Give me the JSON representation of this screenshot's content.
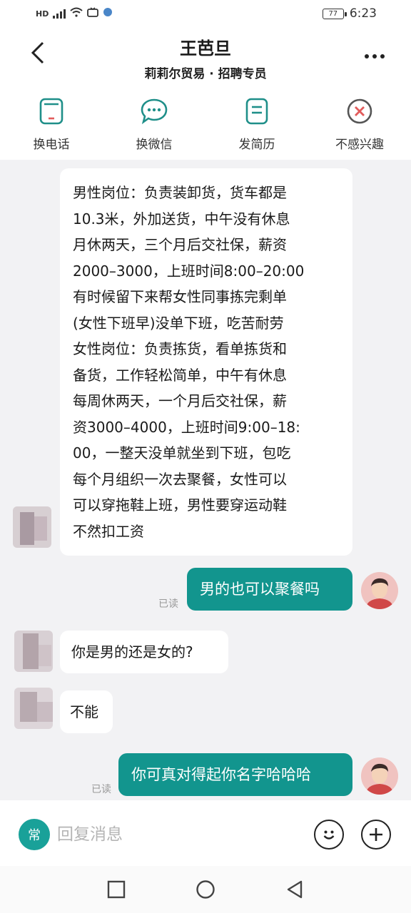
{
  "status_bar": {
    "hd": "HD",
    "network": "5G",
    "battery": "77",
    "time": "6:23"
  },
  "header": {
    "title": "王芭旦",
    "subtitle": "莉莉尔贸易 · 招聘专员"
  },
  "actions": [
    {
      "label": "换电话",
      "icon": "phone-icon"
    },
    {
      "label": "换微信",
      "icon": "wechat-icon"
    },
    {
      "label": "发简历",
      "icon": "resume-icon"
    },
    {
      "label": "不感兴趣",
      "icon": "not-interested-icon"
    }
  ],
  "messages": {
    "m1_lines": [
      "男性岗位：负责装卸货，货车都是",
      "10.3米，外加送货，中午没有休息",
      "月休两天，三个月后交社保，薪资",
      "2000–3000，上班时间8:00–20:00",
      "有时候留下来帮女性同事拣完剩单",
      "(女性下班早)没单下班，吃苦耐劳",
      "女性岗位：负责拣货，看单拣货和",
      "备货，工作轻松简单，中午有休息",
      "每周休两天，一个月后交社保，薪",
      "资3000–4000，上班时间9:00–18:",
      "00，一整天没单就坐到下班，包吃",
      "每个月组织一次去聚餐，女性可以",
      "可以穿拖鞋上班，男性要穿运动鞋",
      "不然扣工资"
    ],
    "m2": "男的也可以聚餐吗",
    "m2_read": "已读",
    "m3": "你是男的还是女的?",
    "m4": "不能",
    "m5": "你可真对得起你名字哈哈哈",
    "m5_read": "已读"
  },
  "input": {
    "chang": "常",
    "placeholder": "回复消息"
  },
  "colors": {
    "accent": "#12958e",
    "accent_light": "#19a199",
    "bubble_bg": "#ffffff",
    "chat_bg": "#f2f2f4"
  }
}
